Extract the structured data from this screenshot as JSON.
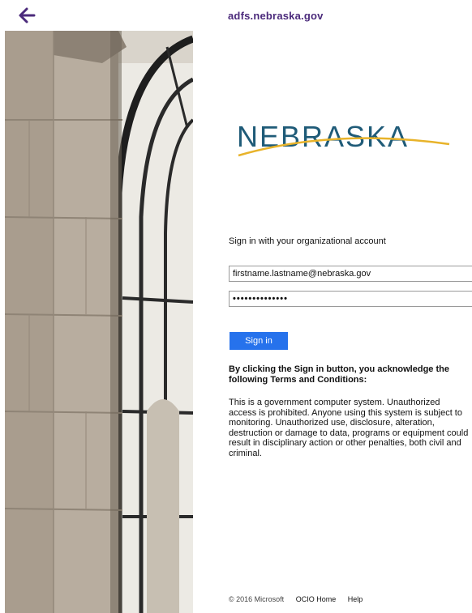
{
  "header": {
    "url": "adfs.nebraska.gov",
    "back_icon": "back-arrow-icon",
    "accent_color": "#4b2a7b"
  },
  "logo": {
    "text": "NEBRASKA",
    "text_color": "#1f5b78",
    "swoosh_color": "#e8b32a"
  },
  "form": {
    "title": "Sign in with your organizational account",
    "username_value": "firstname.lastname@nebraska.gov",
    "password_value": "••••••••••••••",
    "signin_label": "Sign in",
    "button_color": "#2672ec"
  },
  "terms": {
    "heading": "By clicking the Sign in button, you acknowledge the following Terms and Conditions:",
    "body": "This is a government computer system. Unauthorized access is prohibited. Anyone using this system is subject to monitoring. Unauthorized use, disclosure, alteration, destruction or damage to data, programs or equipment could result in disciplinary action or other penalties, both civil and criminal."
  },
  "footer": {
    "copyright": "© 2016 Microsoft",
    "home_link": "OCIO Home",
    "help_link": "Help"
  }
}
